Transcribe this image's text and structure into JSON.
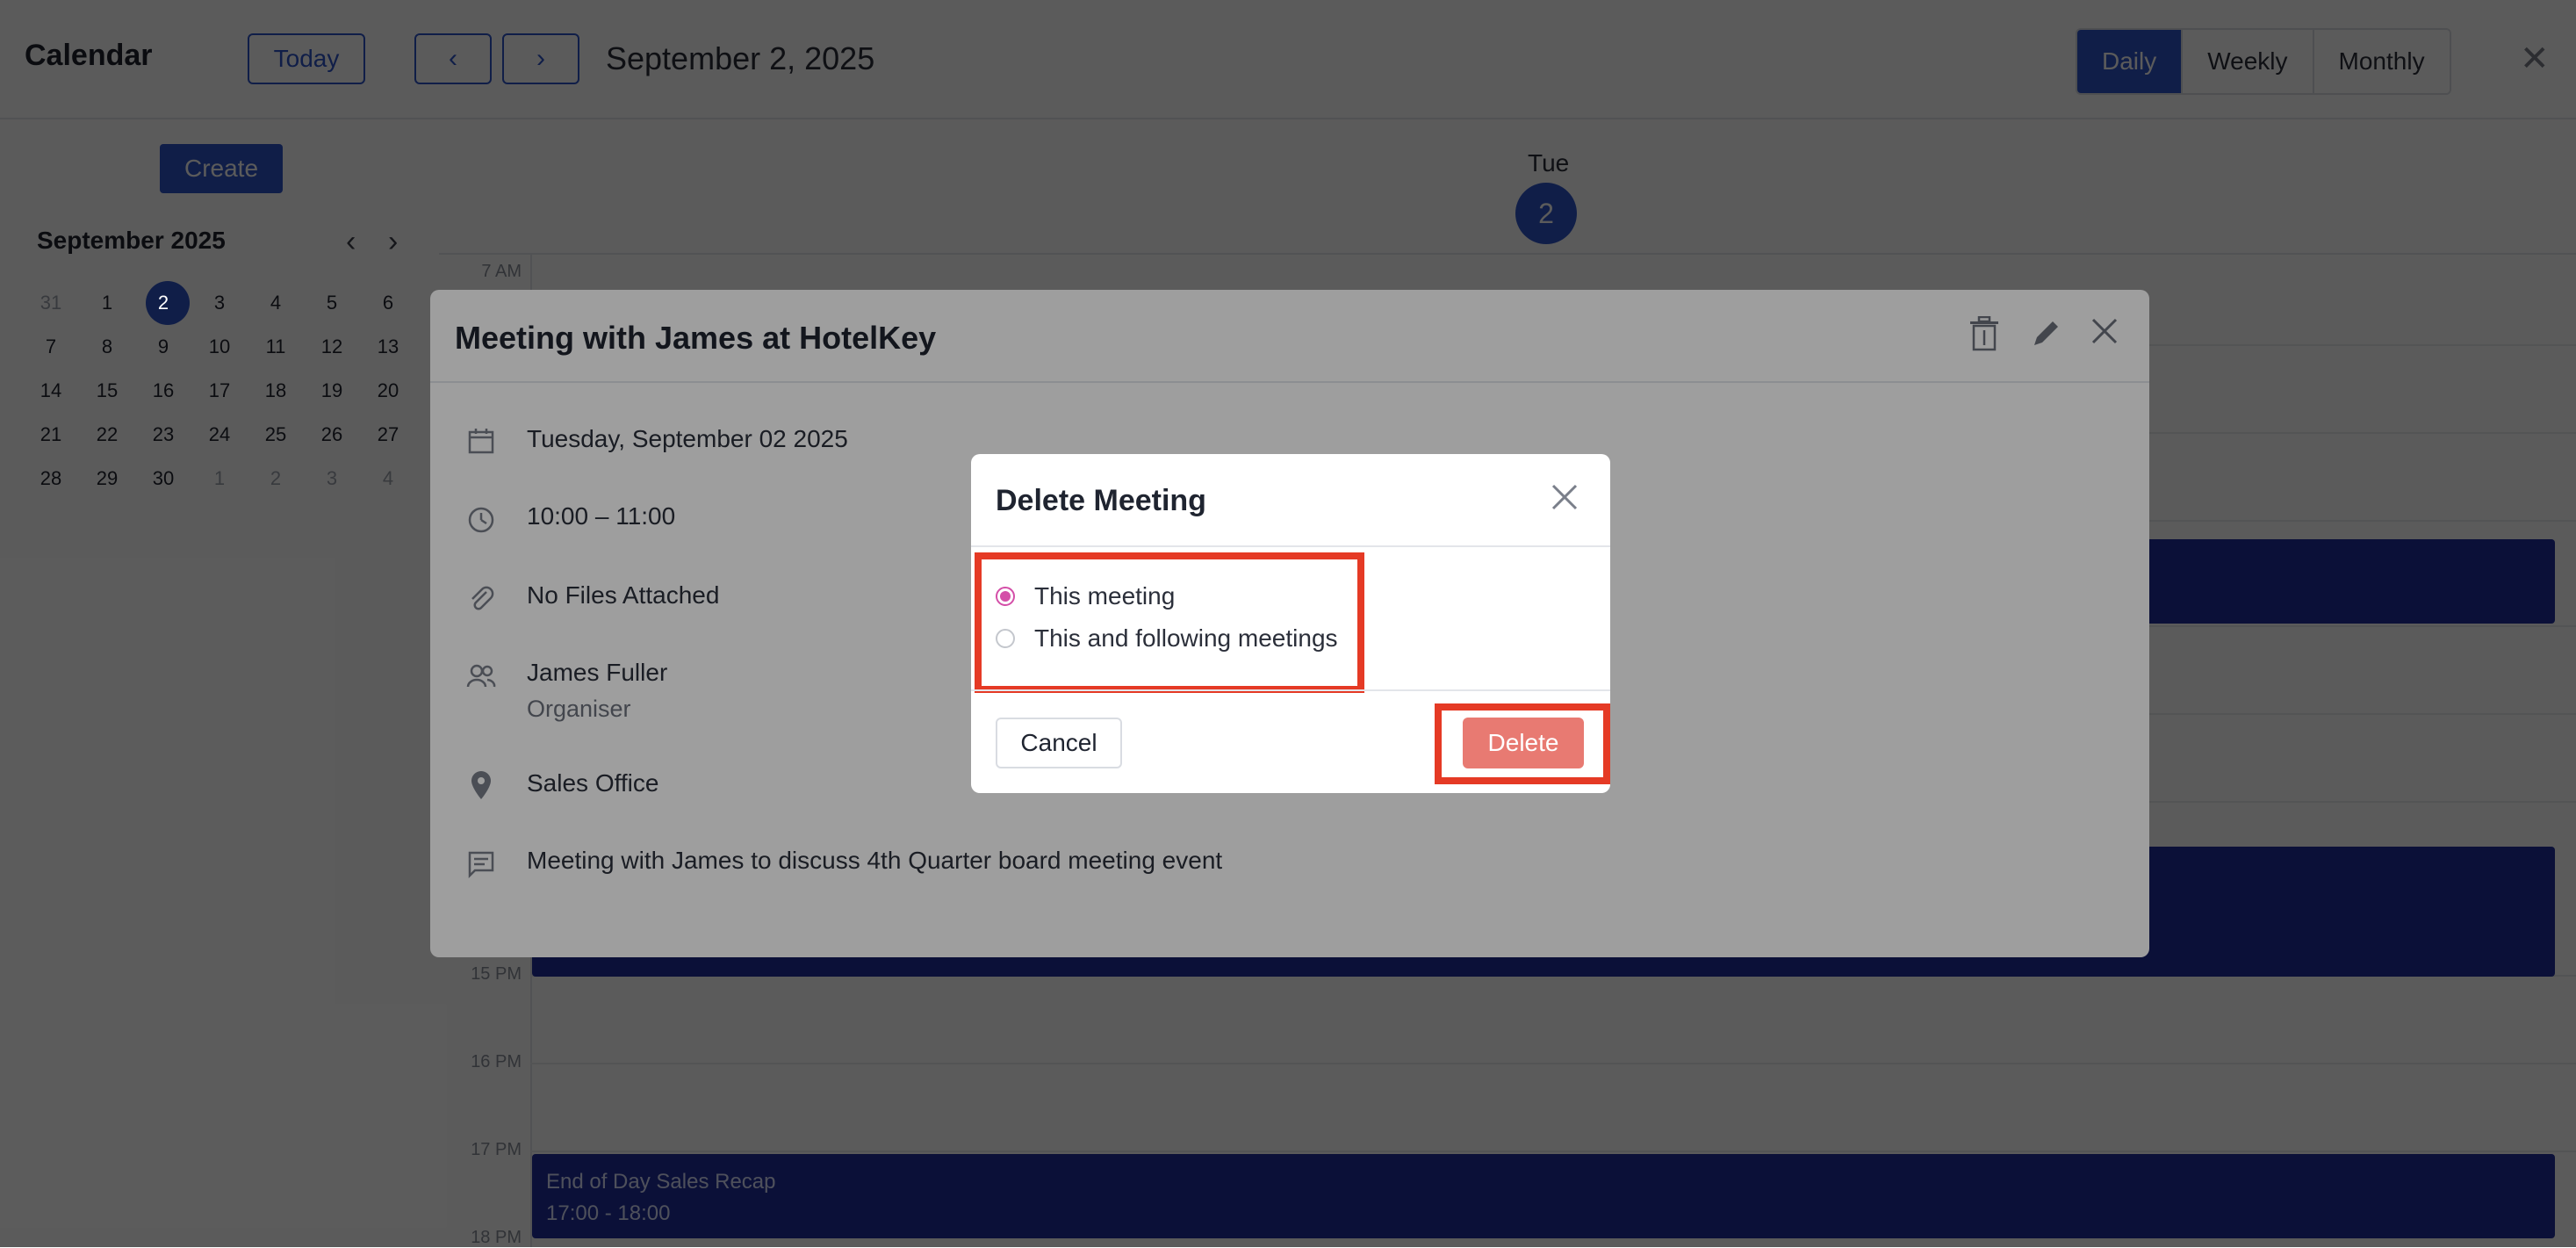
{
  "header": {
    "title": "Calendar",
    "today_label": "Today",
    "prev_icon": "‹",
    "next_icon": "›",
    "current_date": "September 2, 2025",
    "views": [
      "Daily",
      "Weekly",
      "Monthly"
    ],
    "active_view": "Daily",
    "close_icon": "✕"
  },
  "sidebar": {
    "create_label": "Create",
    "month_title": "September 2025",
    "prev_icon": "‹",
    "next_icon": "›",
    "days": [
      {
        "d": "31",
        "muted": true
      },
      {
        "d": "1"
      },
      {
        "d": "2",
        "selected": true
      },
      {
        "d": "3"
      },
      {
        "d": "4"
      },
      {
        "d": "5"
      },
      {
        "d": "6"
      },
      {
        "d": "7"
      },
      {
        "d": "8"
      },
      {
        "d": "9"
      },
      {
        "d": "10"
      },
      {
        "d": "11"
      },
      {
        "d": "12"
      },
      {
        "d": "13"
      },
      {
        "d": "14"
      },
      {
        "d": "15"
      },
      {
        "d": "16"
      },
      {
        "d": "17"
      },
      {
        "d": "18"
      },
      {
        "d": "19"
      },
      {
        "d": "20"
      },
      {
        "d": "21"
      },
      {
        "d": "22"
      },
      {
        "d": "23"
      },
      {
        "d": "24"
      },
      {
        "d": "25"
      },
      {
        "d": "26"
      },
      {
        "d": "27"
      },
      {
        "d": "28"
      },
      {
        "d": "29"
      },
      {
        "d": "30"
      },
      {
        "d": "1",
        "muted": true
      },
      {
        "d": "2",
        "muted": true
      },
      {
        "d": "3",
        "muted": true
      },
      {
        "d": "4",
        "muted": true
      }
    ]
  },
  "day_view": {
    "weekday": "Tue",
    "day_number": "2",
    "time_labels": [
      "7 AM",
      "15 PM",
      "16 PM",
      "17 PM",
      "18 PM"
    ],
    "events": {
      "recap_title": "End of Day Sales Recap",
      "recap_time": "17:00 - 18:00"
    }
  },
  "meeting_modal": {
    "title": "Meeting with James at HotelKey",
    "date": "Tuesday, September 02 2025",
    "time": "10:00 – 11:00",
    "files": "No Files Attached",
    "organiser_name": "James Fuller",
    "organiser_role": "Organiser",
    "location": "Sales Office",
    "description": "Meeting with James to discuss 4th Quarter board meeting event"
  },
  "delete_dialog": {
    "title": "Delete Meeting",
    "options": [
      "This meeting",
      "This and following meetings"
    ],
    "selected_option": "This meeting",
    "cancel_label": "Cancel",
    "delete_label": "Delete"
  },
  "colors": {
    "accent": "#2f55c9",
    "event": "#1f2e9e",
    "radio_selected": "#d44fa8",
    "delete_button": "#e87a72",
    "highlight": "#e53a25"
  }
}
